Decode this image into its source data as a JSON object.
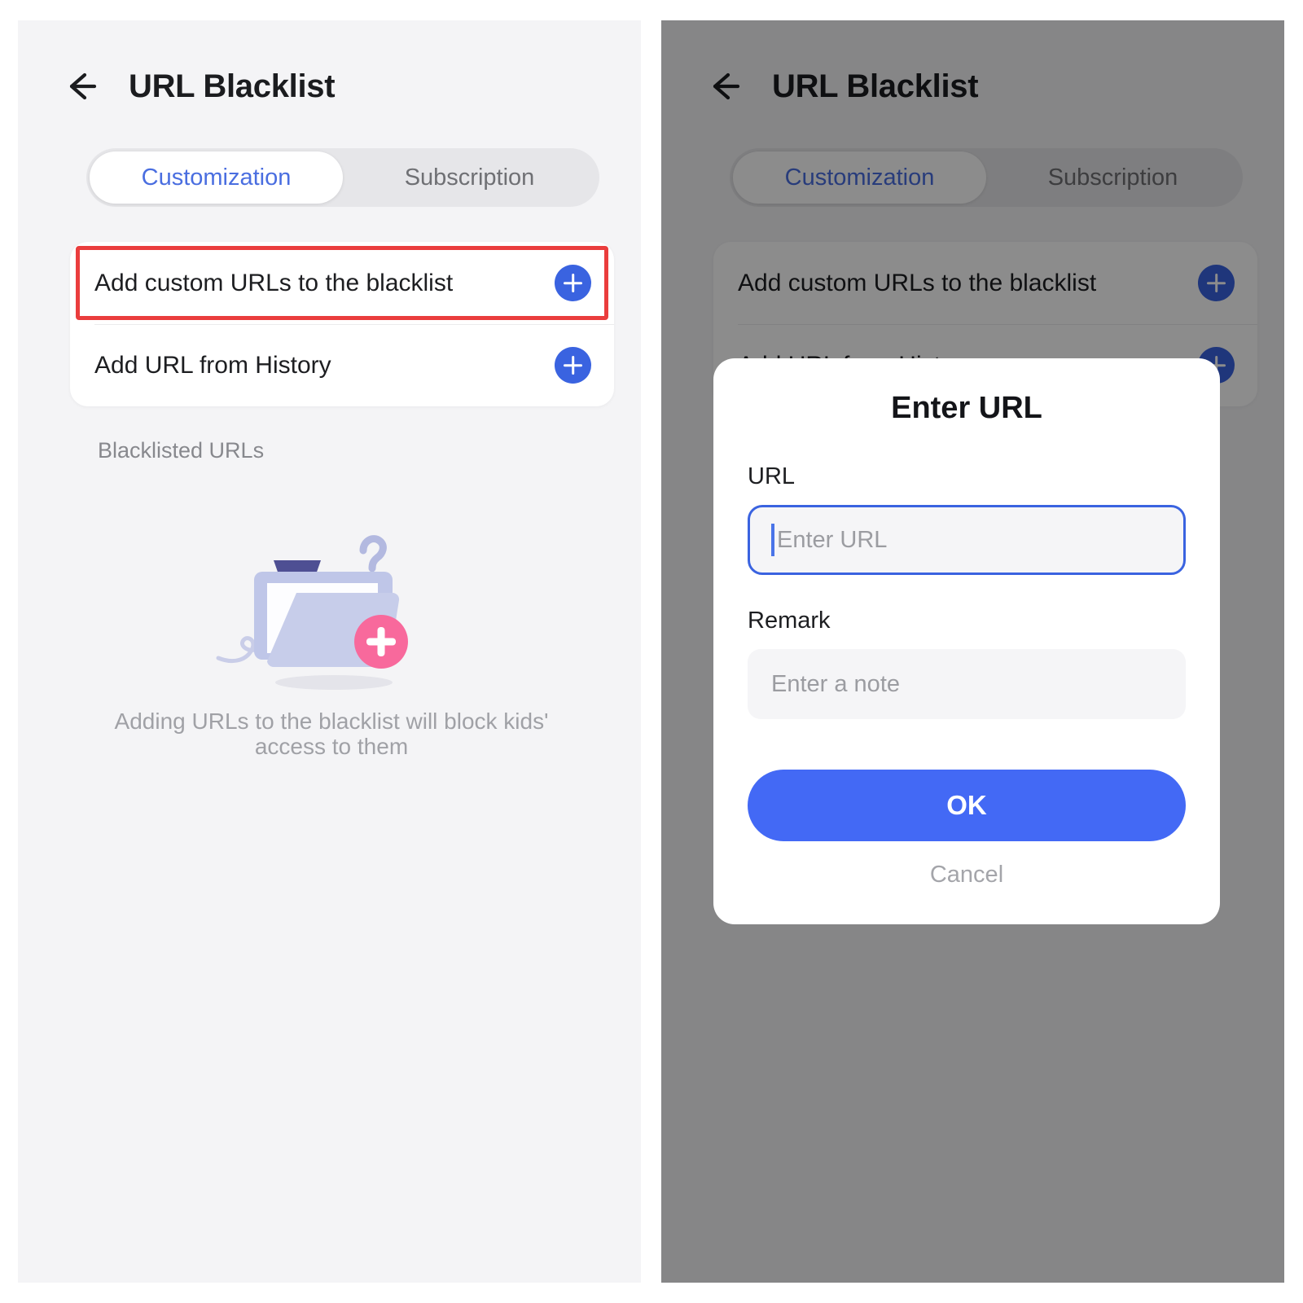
{
  "screen": {
    "title": "URL Blacklist",
    "back_icon": "back-arrow-icon",
    "tabs": [
      {
        "label": "Customization",
        "active": true
      },
      {
        "label": "Subscription",
        "active": false
      }
    ],
    "actions": [
      {
        "label": "Add custom URLs to the blacklist",
        "icon": "plus-circle-icon"
      },
      {
        "label": "Add URL from History",
        "icon": "plus-circle-icon"
      }
    ],
    "section_label": "Blacklisted URLs",
    "empty_state": {
      "illustration": "folder-add-illustration",
      "caption": "Adding URLs to the blacklist will block kids' access to them"
    }
  },
  "annotation": {
    "highlight_color": "#ea3d3d",
    "target": "Add custom URLs to the blacklist"
  },
  "dialog": {
    "title": "Enter URL",
    "url_field": {
      "label": "URL",
      "placeholder": "Enter URL",
      "value": "",
      "focused": true
    },
    "remark_field": {
      "label": "Remark",
      "placeholder": "Enter a note",
      "value": "",
      "focused": false
    },
    "ok_label": "OK",
    "cancel_label": "Cancel"
  },
  "colors": {
    "accent_blue": "#4369f5",
    "icon_blue": "#3a63e0",
    "tab_active_text": "#4a6ee0",
    "highlight_red": "#ea3d3d",
    "page_bg": "#f4f4f6",
    "scrim": "rgba(0,0,0,0.45)"
  }
}
